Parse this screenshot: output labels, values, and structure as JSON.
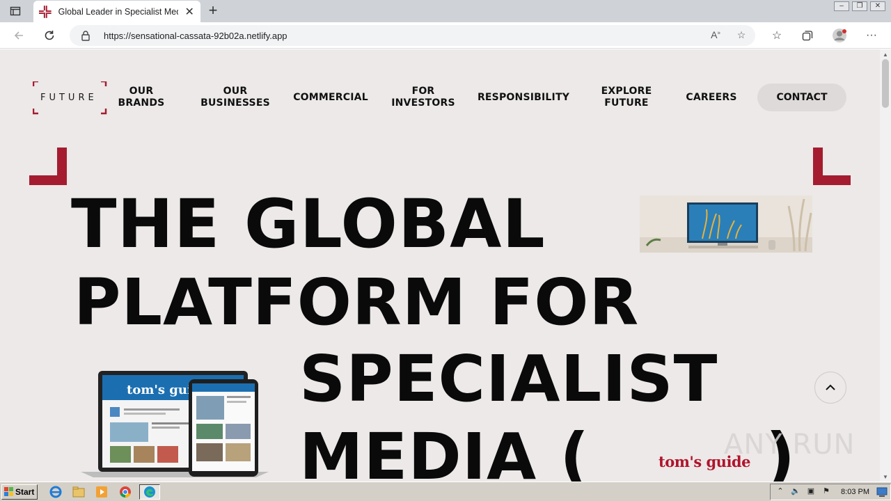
{
  "browser": {
    "tab_title": "Global Leader in Specialist Media",
    "url": "https://sensational-cassata-92b02a.netlify.app",
    "new_tab": "+",
    "close": "✕"
  },
  "site": {
    "logo_text": "FUTURE",
    "nav": {
      "brands": [
        "OUR",
        "BRANDS"
      ],
      "businesses": [
        "OUR",
        "BUSINESSES"
      ],
      "commercial": "COMMERCIAL",
      "investors": [
        "FOR",
        "INVESTORS"
      ],
      "responsibility": "RESPONSIBILITY",
      "explore": [
        "EXPLORE",
        "FUTURE"
      ],
      "careers": "CAREERS",
      "contact": "CONTACT"
    },
    "hero": {
      "line1": "THE GLOBAL",
      "line2": "PLATFORM FOR",
      "line3": "SPECIALIST",
      "line4": "MEDIA (",
      "line4_close": ")"
    },
    "brand_logo": "tom's guide",
    "brand_accent": "#a51c30"
  },
  "watermark": "ANY RUN",
  "taskbar": {
    "start": "Start",
    "clock": "8:03 PM"
  }
}
